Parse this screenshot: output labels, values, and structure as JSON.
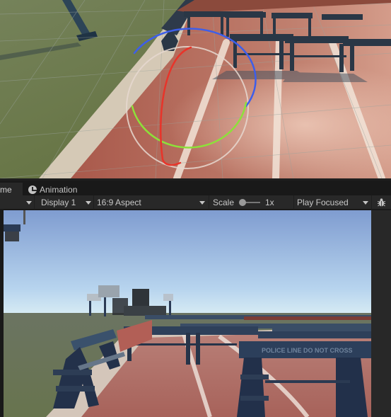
{
  "tabs": [
    {
      "label": "Game",
      "visible_label": "me",
      "active": true
    },
    {
      "label": "Animation",
      "icon": "clock-icon",
      "active": false
    }
  ],
  "toolbar": {
    "game_dropdown_caret": "chevron-down-icon",
    "display": "Display 1",
    "aspect": "16:9 Aspect",
    "scale_label": "Scale",
    "scale_value": "1x",
    "scale_fraction": 0.0,
    "play_mode": "Play Focused",
    "bug_icon": "bug-icon"
  },
  "scene_view": {
    "gizmo": "rotate-gizmo",
    "colors": {
      "x_axis": "#e8342a",
      "y_axis": "#8de13a",
      "z_axis": "#3d5eea",
      "outer": "#e0d4cc"
    }
  },
  "game_view": {
    "barrier_text": "POLICE LINE   DO NOT CROSS",
    "colors": {
      "sky_top": "#7f9cd0",
      "sky_bottom": "#d8ecf4",
      "grass": "#6b7657",
      "track": "#b56e63"
    }
  }
}
